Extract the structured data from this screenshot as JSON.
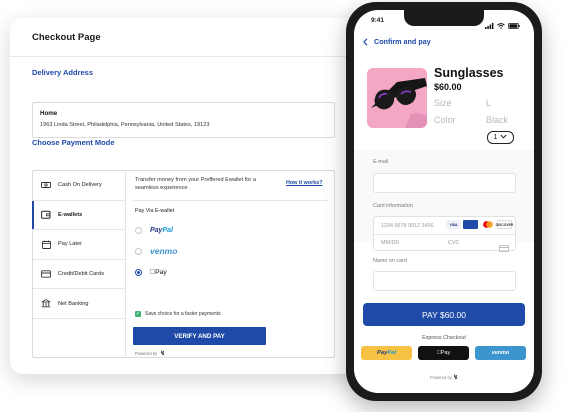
{
  "checkout": {
    "title": "Checkout Page",
    "delivery_heading": "Delivery Address",
    "address": {
      "label": "Home",
      "line": "1963 Linda Street, Philadelphia, Pennsylvania, United States, 19123"
    },
    "payment_heading": "Choose Payment Mode",
    "methods": [
      {
        "label": "Cash On Delivery",
        "icon": "cash-icon"
      },
      {
        "label": "E-wallets",
        "icon": "wallet-icon",
        "active": true
      },
      {
        "label": "Pay Later",
        "icon": "calendar-icon"
      },
      {
        "label": "Credit/Debit Cards",
        "icon": "credit-card-icon"
      },
      {
        "label": "Net Banking",
        "icon": "bank-icon"
      }
    ],
    "ewallet_intro": "Transfer money from your Preffered Ewallet for a seamless experience",
    "how_it_works": "How it works?",
    "pay_via": "Pay Via E-wallet",
    "wallets": [
      {
        "name": "PayPal",
        "logo_a": "Pay",
        "logo_b": "Pal",
        "selected": false
      },
      {
        "name": "venmo",
        "selected": false
      },
      {
        "name": "Pay",
        "prefix": "",
        "selected": true
      }
    ],
    "save_choice": "Save choice for a faster payments",
    "verify_button": "VERIFY AND PAY",
    "powered_by": "Powered by"
  },
  "phone": {
    "time": "9:41",
    "header": "Confirm and pay",
    "product": {
      "name": "Sunglasses",
      "price": "$60.00",
      "size_label": "Size",
      "size_value": "L",
      "color_label": "Color",
      "color_value": "Black",
      "quantity": "1"
    },
    "email_label": "E-mail",
    "card_label": "Card information",
    "card_number_placeholder": "1234 5678 9012 3456",
    "expiry_placeholder": "MM/DD",
    "cvc_placeholder": "CVC",
    "card_brands": [
      "VISA",
      "",
      "DISCOVER"
    ],
    "name_label": "Name on card",
    "pay_button": "PAY $60.00",
    "express_label": "Express Checkout",
    "express": {
      "paypal_a": "Pay",
      "paypal_b": "Pal",
      "apple": "Pay",
      "venmo": "venmo"
    },
    "powered_by": "Powered by"
  },
  "colors": {
    "accent": "#1f4aa8",
    "product_bg": "#f4a7c4",
    "venmo": "#3d95ce",
    "paypal_yellow": "#f7c244",
    "check_green": "#3cb46e"
  }
}
